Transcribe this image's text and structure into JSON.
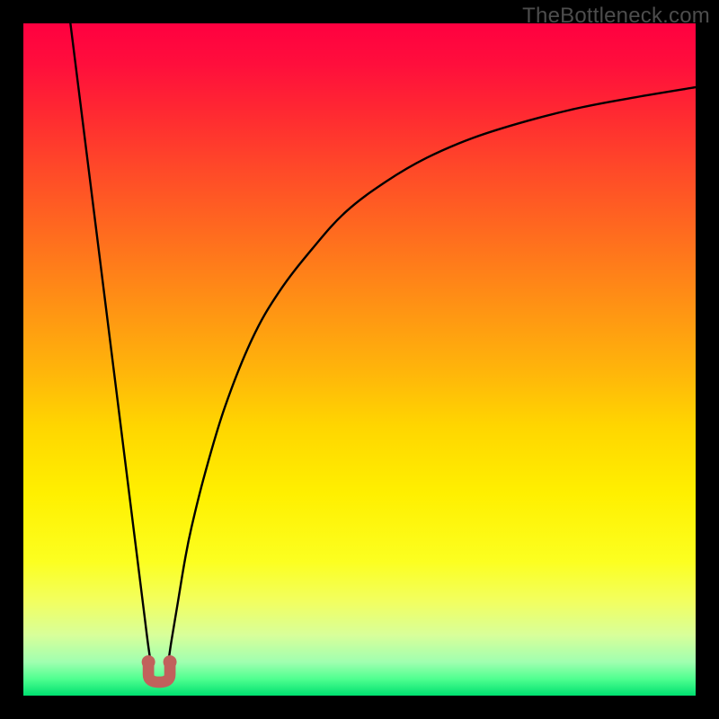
{
  "watermark": "TheBottleneck.com",
  "gradient": {
    "stops": [
      {
        "offset": 0.0,
        "color": "#ff0040"
      },
      {
        "offset": 0.06,
        "color": "#ff0e3c"
      },
      {
        "offset": 0.13,
        "color": "#ff2832"
      },
      {
        "offset": 0.22,
        "color": "#ff4a28"
      },
      {
        "offset": 0.32,
        "color": "#ff6e1e"
      },
      {
        "offset": 0.42,
        "color": "#ff9214"
      },
      {
        "offset": 0.52,
        "color": "#ffb60a"
      },
      {
        "offset": 0.6,
        "color": "#ffd600"
      },
      {
        "offset": 0.7,
        "color": "#fff000"
      },
      {
        "offset": 0.8,
        "color": "#fcff20"
      },
      {
        "offset": 0.86,
        "color": "#f2ff60"
      },
      {
        "offset": 0.91,
        "color": "#d8ff9a"
      },
      {
        "offset": 0.95,
        "color": "#a0ffb0"
      },
      {
        "offset": 0.975,
        "color": "#50ff90"
      },
      {
        "offset": 1.0,
        "color": "#00e070"
      }
    ]
  },
  "chart_data": {
    "type": "line",
    "title": "",
    "xlabel": "",
    "ylabel": "",
    "xlim": [
      0,
      100
    ],
    "ylim": [
      0,
      100
    ],
    "notch_x": 20,
    "series": [
      {
        "name": "left-branch",
        "x": [
          7,
          8,
          9,
          10,
          11,
          12,
          13,
          14,
          15,
          16,
          17,
          18,
          18.5,
          19
        ],
        "values": [
          100,
          92,
          84,
          76,
          68,
          60,
          52,
          44,
          36,
          28,
          20,
          12,
          8,
          4.5
        ]
      },
      {
        "name": "right-branch",
        "x": [
          21.5,
          22,
          23,
          24,
          25,
          27,
          30,
          34,
          38,
          43,
          48,
          54,
          60,
          67,
          75,
          83,
          91,
          100
        ],
        "values": [
          4.5,
          8,
          14,
          20,
          25,
          33,
          43,
          53,
          60,
          66.5,
          72,
          76.5,
          80,
          83,
          85.5,
          87.5,
          89,
          90.5
        ]
      }
    ],
    "notch_marker": {
      "cx": 20.2,
      "cy": 3.5,
      "width": 3.2,
      "height": 3.0,
      "end_radius": 1.0,
      "color": "#c1615c"
    }
  }
}
